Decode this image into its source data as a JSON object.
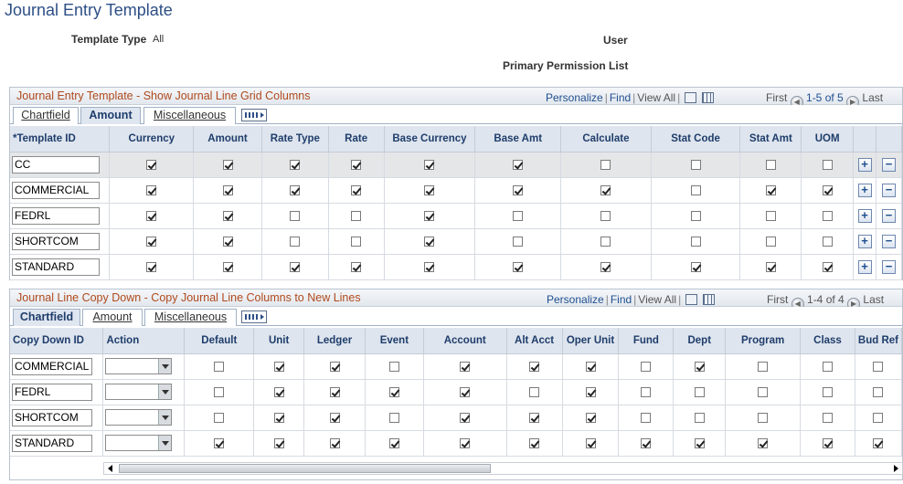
{
  "page": {
    "title": "Journal Entry Template"
  },
  "header": {
    "template_type_label": "Template Type",
    "template_type_value": "All",
    "user_label": "User",
    "primary_permission_label": "Primary Permission List"
  },
  "nav": {
    "personalize": "Personalize",
    "find": "Find",
    "view_all": "View All",
    "first": "First",
    "last": "Last"
  },
  "grid1": {
    "title": "Journal Entry Template - Show Journal Line Grid Columns",
    "range": "1-5 of 5",
    "tabs": [
      "Chartfield",
      "Amount",
      "Miscellaneous"
    ],
    "active_tab": "Amount",
    "columns": [
      "*Template ID",
      "Currency",
      "Amount",
      "Rate Type",
      "Rate",
      "Base Currency",
      "Base Amt",
      "Calculate",
      "Stat Code",
      "Stat Amt",
      "UOM"
    ],
    "rows": [
      {
        "id": "CC",
        "checks": [
          true,
          true,
          true,
          true,
          true,
          true,
          false,
          false,
          false,
          false
        ]
      },
      {
        "id": "COMMERCIAL",
        "checks": [
          true,
          true,
          true,
          true,
          true,
          true,
          true,
          false,
          true,
          true
        ]
      },
      {
        "id": "FEDRL",
        "checks": [
          true,
          true,
          false,
          false,
          true,
          false,
          false,
          false,
          false,
          false
        ]
      },
      {
        "id": "SHORTCOM",
        "checks": [
          true,
          true,
          false,
          false,
          true,
          false,
          false,
          false,
          false,
          false
        ]
      },
      {
        "id": "STANDARD",
        "checks": [
          true,
          true,
          true,
          true,
          true,
          true,
          true,
          true,
          true,
          true
        ]
      }
    ]
  },
  "grid2": {
    "title": "Journal Line Copy Down - Copy Journal Line Columns to New Lines",
    "range": "1-4 of 4",
    "tabs": [
      "Chartfield",
      "Amount",
      "Miscellaneous"
    ],
    "active_tab": "Chartfield",
    "columns": [
      "Copy Down ID",
      "Action",
      "Default",
      "Unit",
      "Ledger",
      "Event",
      "Account",
      "Alt Acct",
      "Oper Unit",
      "Fund",
      "Dept",
      "Program",
      "Class",
      "Bud Ref"
    ],
    "rows": [
      {
        "id": "COMMERCIAL",
        "action": "",
        "checks": [
          false,
          true,
          true,
          false,
          true,
          true,
          true,
          false,
          true,
          false,
          false,
          false
        ]
      },
      {
        "id": "FEDRL",
        "action": "",
        "checks": [
          false,
          true,
          true,
          true,
          true,
          false,
          true,
          false,
          false,
          false,
          false,
          false
        ]
      },
      {
        "id": "SHORTCOM",
        "action": "",
        "checks": [
          false,
          true,
          true,
          false,
          true,
          true,
          true,
          false,
          false,
          false,
          false,
          false
        ]
      },
      {
        "id": "STANDARD",
        "action": "",
        "checks": [
          true,
          true,
          true,
          true,
          true,
          true,
          true,
          true,
          true,
          true,
          true,
          true
        ]
      }
    ]
  }
}
